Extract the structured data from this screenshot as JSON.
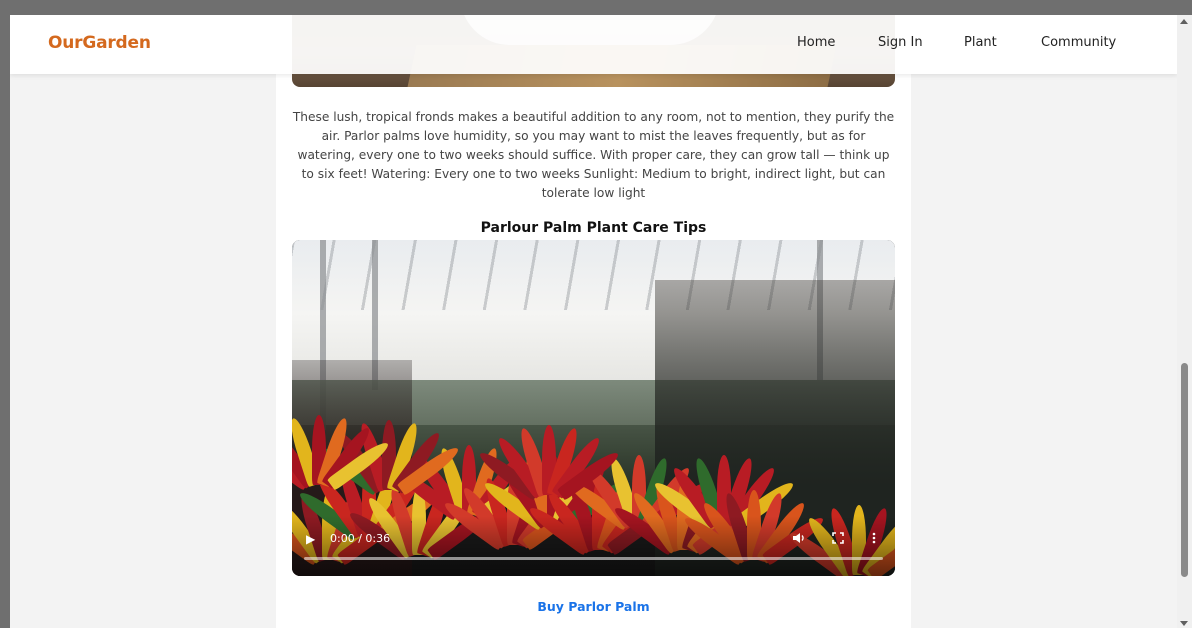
{
  "brand": {
    "name": "OurGarden",
    "color": "#d4691e"
  },
  "nav": {
    "items": [
      {
        "label": "Home"
      },
      {
        "label": "Sign In"
      },
      {
        "label": "Plant"
      },
      {
        "label": "Community"
      }
    ]
  },
  "article": {
    "description": "These lush, tropical fronds makes a beautiful addition to any room, not to mention, they purify the air. Parlor palms love humidity, so you may want to mist the leaves frequently, but as for watering, every one to two weeks should suffice. With proper care, they can grow tall — think up to six feet! Watering: Every one to two weeks Sunlight: Medium to bright, indirect light, but can tolerate low light",
    "video_title": "Parlour Palm Plant Care Tips",
    "video": {
      "time": "0:00 / 0:36",
      "play_icon": "play-icon",
      "volume_icon": "volume-icon",
      "fullscreen_icon": "fullscreen-icon",
      "menu_icon": "more-options-icon"
    },
    "buy_link": "Buy Parlor Palm",
    "link_color": "#1a73e8"
  }
}
